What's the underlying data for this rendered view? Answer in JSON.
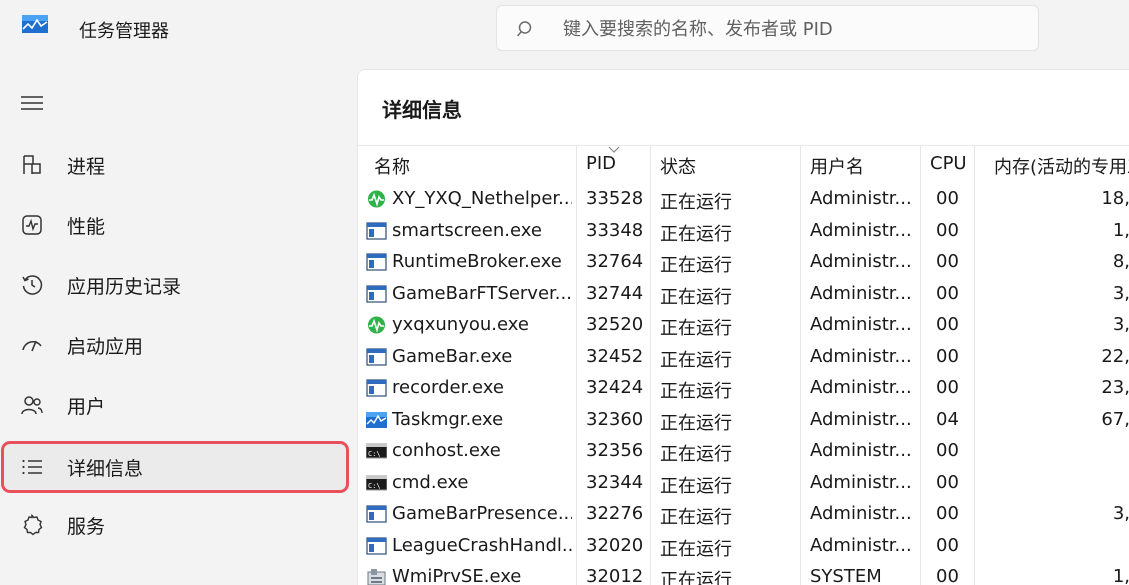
{
  "app": {
    "title": "任务管理器",
    "accent_color": "#e8505b"
  },
  "search": {
    "placeholder": "键入要搜索的名称、发布者或 PID",
    "icon": "search-icon"
  },
  "sidebar": {
    "menu_icon": "hamburger-menu-icon",
    "items": [
      {
        "label": "进程",
        "icon": "processes-icon",
        "active": false
      },
      {
        "label": "性能",
        "icon": "performance-icon",
        "active": false
      },
      {
        "label": "应用历史记录",
        "icon": "history-icon",
        "active": false
      },
      {
        "label": "启动应用",
        "icon": "startup-icon",
        "active": false
      },
      {
        "label": "用户",
        "icon": "users-icon",
        "active": false
      },
      {
        "label": "详细信息",
        "icon": "details-icon",
        "active": true
      },
      {
        "label": "服务",
        "icon": "services-icon",
        "active": false
      }
    ]
  },
  "details": {
    "title": "详细信息",
    "columns": {
      "name": "名称",
      "pid": "PID",
      "status": "状态",
      "user": "用户名",
      "cpu": "CPU",
      "memory": "内存(活动的专用工"
    },
    "sorted_column": "pid",
    "rows": [
      {
        "icon": "green-wave-icon",
        "name": "XY_YXQ_Nethelper...",
        "pid": "33528",
        "status": "正在运行",
        "user": "Administr...",
        "cpu": "00",
        "memory": "18,"
      },
      {
        "icon": "app-window-icon",
        "name": "smartscreen.exe",
        "pid": "33348",
        "status": "正在运行",
        "user": "Administr...",
        "cpu": "00",
        "memory": "1,"
      },
      {
        "icon": "app-window-icon",
        "name": "RuntimeBroker.exe",
        "pid": "32764",
        "status": "正在运行",
        "user": "Administr...",
        "cpu": "00",
        "memory": "8,"
      },
      {
        "icon": "app-window-icon",
        "name": "GameBarFTServer....",
        "pid": "32744",
        "status": "正在运行",
        "user": "Administr...",
        "cpu": "00",
        "memory": "3,"
      },
      {
        "icon": "green-wave-icon",
        "name": "yxqxunyou.exe",
        "pid": "32520",
        "status": "正在运行",
        "user": "Administr...",
        "cpu": "00",
        "memory": "3,"
      },
      {
        "icon": "app-window-icon",
        "name": "GameBar.exe",
        "pid": "32452",
        "status": "正在运行",
        "user": "Administr...",
        "cpu": "00",
        "memory": "22,"
      },
      {
        "icon": "app-window-icon",
        "name": "recorder.exe",
        "pid": "32424",
        "status": "正在运行",
        "user": "Administr...",
        "cpu": "00",
        "memory": "23,"
      },
      {
        "icon": "taskmgr-icon",
        "name": "Taskmgr.exe",
        "pid": "32360",
        "status": "正在运行",
        "user": "Administr...",
        "cpu": "04",
        "memory": "67,"
      },
      {
        "icon": "console-icon",
        "name": "conhost.exe",
        "pid": "32356",
        "status": "正在运行",
        "user": "Administr...",
        "cpu": "00",
        "memory": ""
      },
      {
        "icon": "console-icon",
        "name": "cmd.exe",
        "pid": "32344",
        "status": "正在运行",
        "user": "Administr...",
        "cpu": "00",
        "memory": ""
      },
      {
        "icon": "app-window-icon",
        "name": "GameBarPresence...",
        "pid": "32276",
        "status": "正在运行",
        "user": "Administr...",
        "cpu": "00",
        "memory": "3,"
      },
      {
        "icon": "app-window-icon",
        "name": "LeagueCrashHandl...",
        "pid": "32020",
        "status": "正在运行",
        "user": "Administr...",
        "cpu": "00",
        "memory": ""
      },
      {
        "icon": "wmi-icon",
        "name": "WmiPrvSE.exe",
        "pid": "32012",
        "status": "正在运行",
        "user": "SYSTEM",
        "cpu": "00",
        "memory": "1,"
      }
    ]
  }
}
